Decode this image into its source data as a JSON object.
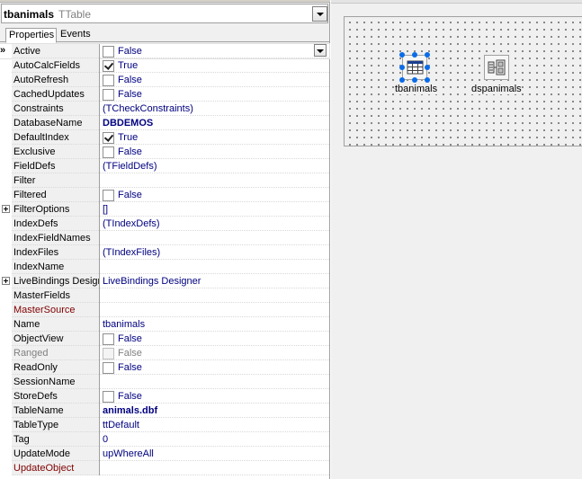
{
  "inspector": {
    "component_name": "tbanimals",
    "component_type": "TTable",
    "tabs": [
      {
        "label": "Properties",
        "active": true
      },
      {
        "label": "Events",
        "active": false
      }
    ],
    "properties": [
      {
        "name": "Active",
        "value": "False",
        "checkbox": "unchecked",
        "active": true
      },
      {
        "name": "AutoCalcFields",
        "value": "True",
        "checkbox": "checked"
      },
      {
        "name": "AutoRefresh",
        "value": "False",
        "checkbox": "unchecked"
      },
      {
        "name": "CachedUpdates",
        "value": "False",
        "checkbox": "unchecked"
      },
      {
        "name": "Constraints",
        "value": "(TCheckConstraints)"
      },
      {
        "name": "DatabaseName",
        "value": "DBDEMOS",
        "bold": true
      },
      {
        "name": "DefaultIndex",
        "value": "True",
        "checkbox": "checked"
      },
      {
        "name": "Exclusive",
        "value": "False",
        "checkbox": "unchecked"
      },
      {
        "name": "FieldDefs",
        "value": "(TFieldDefs)"
      },
      {
        "name": "Filter",
        "value": ""
      },
      {
        "name": "Filtered",
        "value": "False",
        "checkbox": "unchecked"
      },
      {
        "name": "FilterOptions",
        "value": "[]",
        "expandable": true
      },
      {
        "name": "IndexDefs",
        "value": "(TIndexDefs)"
      },
      {
        "name": "IndexFieldNames",
        "value": ""
      },
      {
        "name": "IndexFiles",
        "value": "(TIndexFiles)"
      },
      {
        "name": "IndexName",
        "value": ""
      },
      {
        "name": "LiveBindings Designer",
        "value": "LiveBindings Designer",
        "expandable": true
      },
      {
        "name": "MasterFields",
        "value": ""
      },
      {
        "name": "MasterSource",
        "value": "",
        "kind": "ref"
      },
      {
        "name": "Name",
        "value": "tbanimals"
      },
      {
        "name": "ObjectView",
        "value": "False",
        "checkbox": "unchecked"
      },
      {
        "name": "Ranged",
        "value": "False",
        "checkbox": "disabled",
        "kind": "ro"
      },
      {
        "name": "ReadOnly",
        "value": "False",
        "checkbox": "unchecked"
      },
      {
        "name": "SessionName",
        "value": ""
      },
      {
        "name": "StoreDefs",
        "value": "False",
        "checkbox": "unchecked"
      },
      {
        "name": "TableName",
        "value": "animals.dbf",
        "bold": true
      },
      {
        "name": "TableType",
        "value": "ttDefault"
      },
      {
        "name": "Tag",
        "value": "0"
      },
      {
        "name": "UpdateMode",
        "value": "upWhereAll"
      },
      {
        "name": "UpdateObject",
        "value": "",
        "kind": "ref"
      }
    ]
  },
  "designer": {
    "components": [
      {
        "label": "tbanimals",
        "icon": "table-icon",
        "selected": true
      },
      {
        "label": "dspanimals",
        "icon": "datasource-icon",
        "selected": false
      }
    ]
  },
  "colors": {
    "selection_handle": "#0a6ce8",
    "value_text": "#000080",
    "reference_property": "#800000"
  }
}
